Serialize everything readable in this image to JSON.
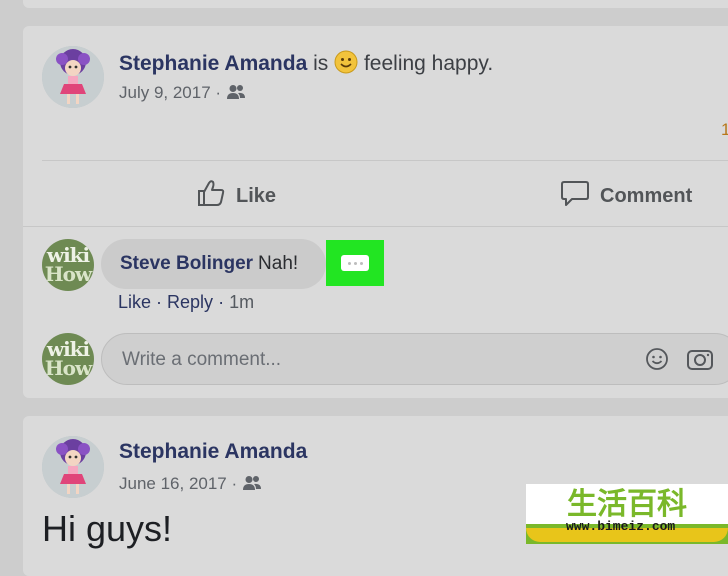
{
  "post1": {
    "author": "Stephanie Amanda",
    "verb": "is",
    "activity": "feeling happy.",
    "date": "July 9, 2017",
    "dot": "·",
    "reaction_count_partial": "1"
  },
  "actions": {
    "like_label": "Like",
    "comment_label": "Comment"
  },
  "comment": {
    "author": "Steve Bolinger",
    "text": "Nah!",
    "like_link": "Like",
    "reply_link": "Reply",
    "sep": "·",
    "time": "1m"
  },
  "composer": {
    "placeholder": "Write a comment..."
  },
  "avatar_wiki": {
    "line1": "wiki",
    "line2": "How"
  },
  "post2": {
    "author": "Stephanie Amanda",
    "date": "June 16, 2017",
    "dot": "·",
    "text": "Hi guys!"
  },
  "watermark": {
    "chars": "生活百科",
    "url": "www.bimeiz.com"
  },
  "colors": {
    "highlight": "#22e522",
    "name_blue": "#2b3562",
    "card_bg": "#dadada"
  },
  "icons": {
    "audience": "friends-icon",
    "like": "thumbs-up-icon",
    "comment": "speech-bubble-icon",
    "emoji": "smiley-icon",
    "camera": "camera-icon",
    "more": "ellipsis-icon"
  }
}
